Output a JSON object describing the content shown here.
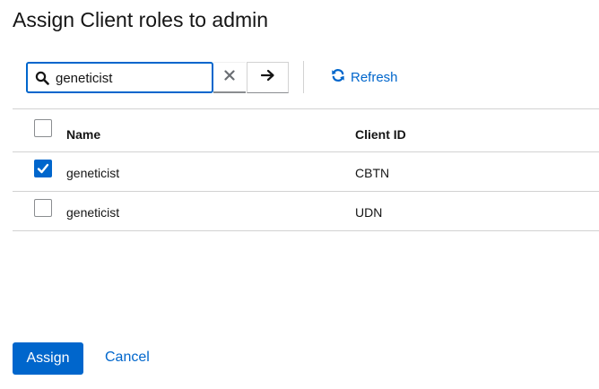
{
  "modal": {
    "title": "Assign Client roles to admin"
  },
  "toolbar": {
    "search_value": "geneticist",
    "refresh_label": "Refresh"
  },
  "table": {
    "columns": [
      "Name",
      "Client ID"
    ],
    "header_checked": false,
    "rows": [
      {
        "name": "geneticist",
        "client_id": "CBTN",
        "checked": true
      },
      {
        "name": "geneticist",
        "client_id": "UDN",
        "checked": false
      }
    ]
  },
  "footer": {
    "assign_label": "Assign",
    "cancel_label": "Cancel"
  },
  "colors": {
    "accent": "#0066cc",
    "text": "#151515",
    "border": "#d2d2d2"
  }
}
